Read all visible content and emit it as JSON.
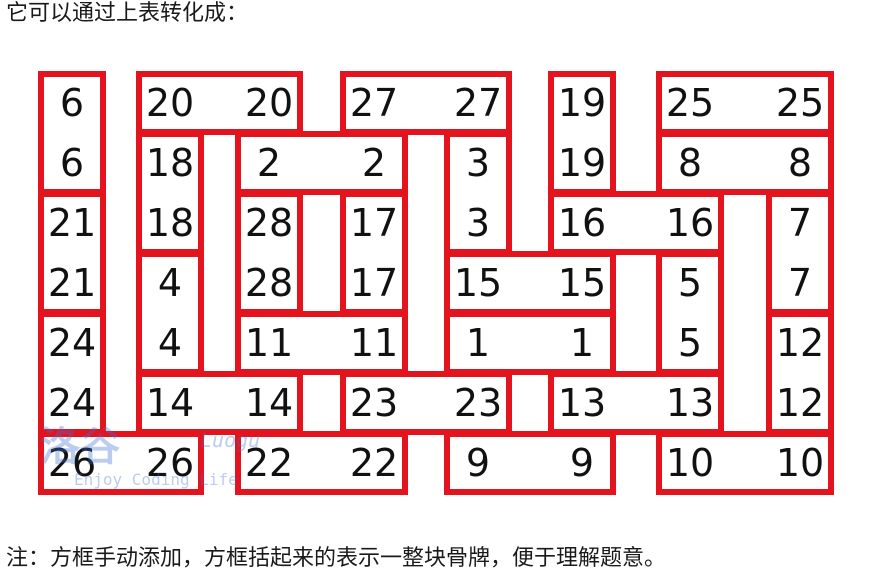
{
  "top_caption": "它可以通过上表转化成：",
  "bottom_caption": "注：方框手动添加，方框括起来的表示一整块骨牌，便于理解题意。",
  "grid": {
    "rows": [
      [
        "6",
        "20",
        "20",
        "27",
        "27",
        "19",
        "25",
        "25"
      ],
      [
        "6",
        "18",
        "2",
        "2",
        "3",
        "19",
        "8",
        "8"
      ],
      [
        "21",
        "18",
        "28",
        "17",
        "3",
        "16",
        "16",
        "7"
      ],
      [
        "21",
        "4",
        "28",
        "17",
        "15",
        "15",
        "5",
        "7"
      ],
      [
        "24",
        "4",
        "11",
        "11",
        "1",
        "1",
        "5",
        "12"
      ],
      [
        "24",
        "14",
        "14",
        "23",
        "23",
        "13",
        "13",
        "12"
      ],
      [
        "26",
        "26",
        "22",
        "22",
        "9",
        "9",
        "10",
        "10"
      ]
    ]
  },
  "watermark": {
    "brand": "洛谷",
    "sub": "Luogu",
    "slogan": "Enjoy Coding Life"
  },
  "colors": {
    "box_border": "#e3141e",
    "text": "#111111",
    "watermark": "#3b6fd6"
  }
}
